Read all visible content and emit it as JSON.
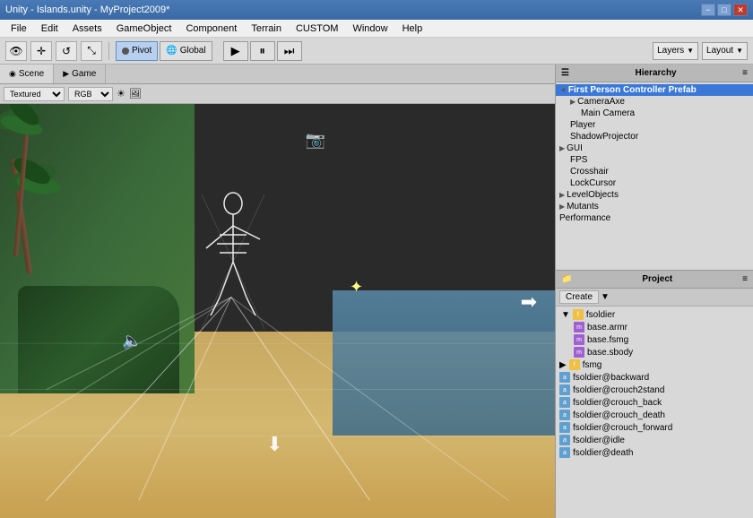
{
  "titlebar": {
    "title": "Unity - Islands.unity - MyProject2009*",
    "minimize": "−",
    "maximize": "□",
    "close": "✕"
  },
  "menubar": {
    "items": [
      "File",
      "Edit",
      "Assets",
      "GameObject",
      "Component",
      "Terrain",
      "CUSTOM",
      "Window",
      "Help"
    ]
  },
  "toolbar": {
    "pivot_label": "Pivot",
    "global_label": "Global",
    "layers_label": "Layers",
    "layout_label": "Layout",
    "play": "▶",
    "pause": "⏸",
    "step": "⏭"
  },
  "viewport": {
    "tabs": [
      "Scene",
      "Game"
    ],
    "shading": "Textured",
    "channel": "RGB"
  },
  "hierarchy": {
    "title": "Hierarchy",
    "items": [
      {
        "id": "fpc",
        "label": "First Person Controller Prefab",
        "indent": 0,
        "expanded": true,
        "selected": true,
        "root": true
      },
      {
        "id": "cameraAxe",
        "label": "CameraAxe",
        "indent": 1,
        "expanded": true
      },
      {
        "id": "mainCamera",
        "label": "Main Camera",
        "indent": 2
      },
      {
        "id": "player",
        "label": "Player",
        "indent": 1
      },
      {
        "id": "shadowProjector",
        "label": "ShadowProjector",
        "indent": 1
      },
      {
        "id": "gui",
        "label": "GUI",
        "indent": 0,
        "expanded": true
      },
      {
        "id": "fps",
        "label": "FPS",
        "indent": 1
      },
      {
        "id": "crosshair",
        "label": "Crosshair",
        "indent": 1
      },
      {
        "id": "lockCursor",
        "label": "LockCursor",
        "indent": 1
      },
      {
        "id": "levelObjects",
        "label": "LevelObjects",
        "indent": 0
      },
      {
        "id": "mutants",
        "label": "Mutants",
        "indent": 0
      },
      {
        "id": "performance",
        "label": "Performance",
        "indent": 0
      }
    ]
  },
  "project": {
    "title": "Project",
    "create_label": "Create",
    "items": [
      {
        "id": "fsoldier",
        "label": "fsoldier",
        "indent": 0,
        "type": "folder",
        "expanded": true
      },
      {
        "id": "base_armr",
        "label": "base.armr",
        "indent": 1,
        "type": "mesh"
      },
      {
        "id": "base_fsmg",
        "label": "base.fsmg",
        "indent": 1,
        "type": "mesh"
      },
      {
        "id": "base_sbody",
        "label": "base.sbody",
        "indent": 1,
        "type": "mesh"
      },
      {
        "id": "fsmg",
        "label": "fsmg",
        "indent": 0,
        "type": "folder"
      },
      {
        "id": "fsoldier_backward",
        "label": "fsoldier@backward",
        "indent": 0,
        "type": "anim"
      },
      {
        "id": "fsoldier_crouch2stand",
        "label": "fsoldier@crouch2stand",
        "indent": 0,
        "type": "anim"
      },
      {
        "id": "fsoldier_crouch_back",
        "label": "fsoldier@crouch_back",
        "indent": 0,
        "type": "anim"
      },
      {
        "id": "fsoldier_crouch_death",
        "label": "fsoldier@crouch_death",
        "indent": 0,
        "type": "anim"
      },
      {
        "id": "fsoldier_crouch_forward",
        "label": "fsoldier@crouch_forward",
        "indent": 0,
        "type": "anim"
      },
      {
        "id": "fsoldier_idle",
        "label": "fsoldier@idle",
        "indent": 0,
        "type": "anim"
      },
      {
        "id": "fsoldier_death",
        "label": "fsoldier@death",
        "indent": 0,
        "type": "anim"
      }
    ]
  },
  "icons": {
    "eye": "👁",
    "move": "✛",
    "rotate": "↺",
    "scale": "⤡",
    "pivot": "⊙",
    "global": "🌐",
    "camera": "📷",
    "sun": "☀",
    "speaker": "🔈",
    "folder": "📁",
    "arrow_right": "▶",
    "arrow_down": "▼",
    "arrow_up": "↑",
    "scene": "◉",
    "game": "🎮"
  }
}
